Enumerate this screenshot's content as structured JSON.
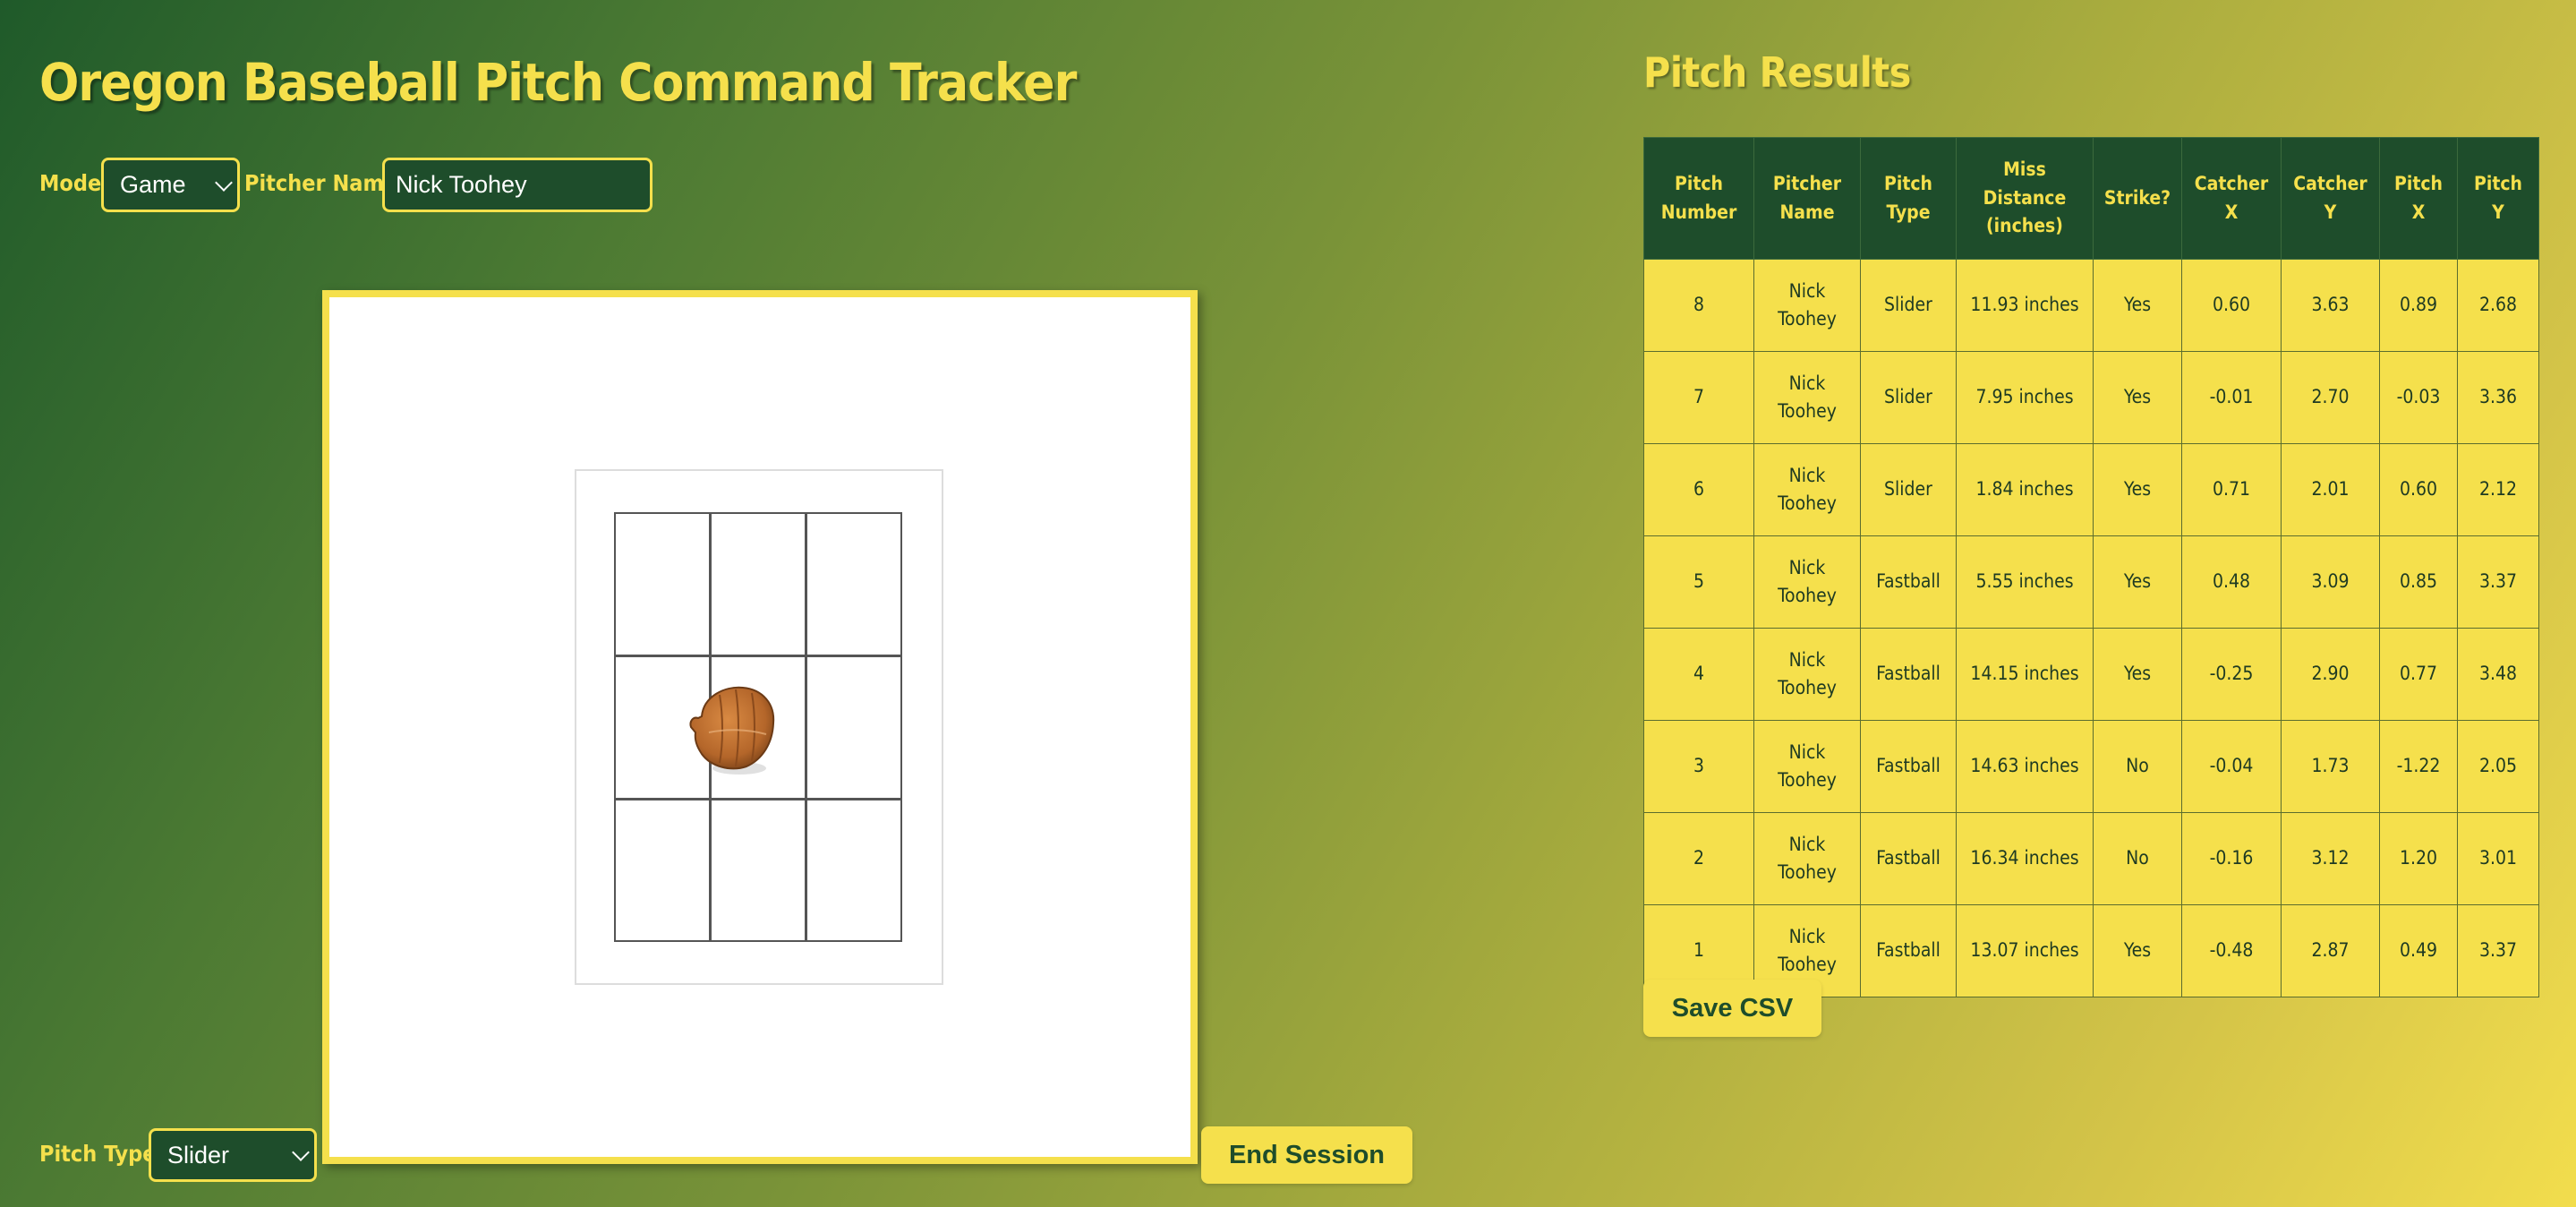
{
  "app": {
    "title": "Oregon Baseball Pitch Command Tracker"
  },
  "controls": {
    "mode_label": "Mode:",
    "mode_value": "Game",
    "pitcher_label": "Pitcher Name:",
    "pitcher_value": "Nick Toohey",
    "pitch_type_label": "Pitch Type:",
    "pitch_type_value": "Slider",
    "end_session_label": "End Session"
  },
  "colors": {
    "green": "#1e4d2b",
    "yellow": "#f5e04c"
  },
  "icons": {
    "glove": "catcher-glove-icon"
  },
  "results": {
    "title": "Pitch Results",
    "save_label": "Save CSV",
    "columns": [
      [
        "Pitch",
        "Number"
      ],
      [
        "Pitcher",
        "Name"
      ],
      [
        "Pitch",
        "Type"
      ],
      [
        "Miss",
        "Distance",
        "(inches)"
      ],
      [
        "Strike?"
      ],
      [
        "Catcher",
        "X"
      ],
      [
        "Catcher",
        "Y"
      ],
      [
        "Pitch",
        "X"
      ],
      [
        "Pitch",
        "Y"
      ]
    ],
    "rows": [
      [
        "8",
        "Nick Toohey",
        "Slider",
        "11.93 inches",
        "Yes",
        "0.60",
        "3.63",
        "0.89",
        "2.68"
      ],
      [
        "7",
        "Nick Toohey",
        "Slider",
        "7.95 inches",
        "Yes",
        "-0.01",
        "2.70",
        "-0.03",
        "3.36"
      ],
      [
        "6",
        "Nick Toohey",
        "Slider",
        "1.84 inches",
        "Yes",
        "0.71",
        "2.01",
        "0.60",
        "2.12"
      ],
      [
        "5",
        "Nick Toohey",
        "Fastball",
        "5.55 inches",
        "Yes",
        "0.48",
        "3.09",
        "0.85",
        "3.37"
      ],
      [
        "4",
        "Nick Toohey",
        "Fastball",
        "14.15 inches",
        "Yes",
        "-0.25",
        "2.90",
        "0.77",
        "3.48"
      ],
      [
        "3",
        "Nick Toohey",
        "Fastball",
        "14.63 inches",
        "No",
        "-0.04",
        "1.73",
        "-1.22",
        "2.05"
      ],
      [
        "2",
        "Nick Toohey",
        "Fastball",
        "16.34 inches",
        "No",
        "-0.16",
        "3.12",
        "1.20",
        "3.01"
      ],
      [
        "1",
        "Nick Toohey",
        "Fastball",
        "13.07 inches",
        "Yes",
        "-0.48",
        "2.87",
        "0.49",
        "3.37"
      ]
    ]
  }
}
